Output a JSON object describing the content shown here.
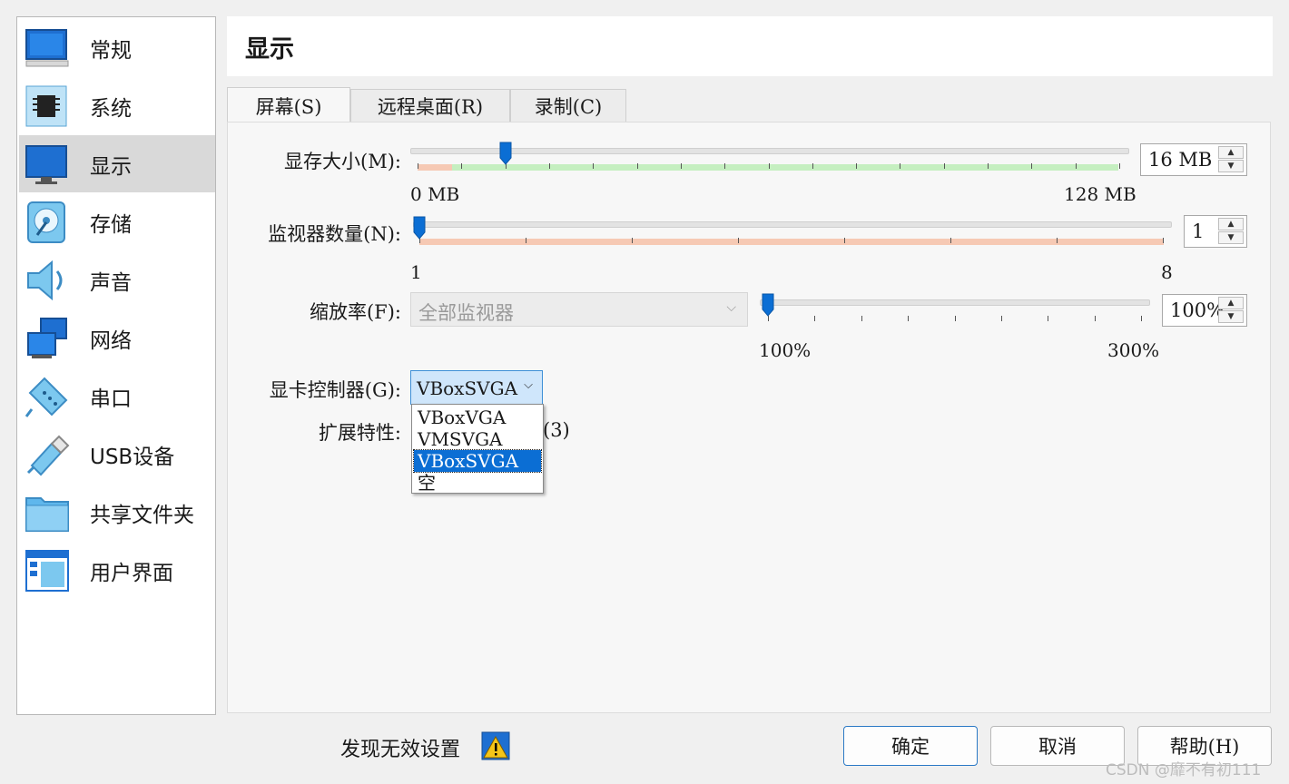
{
  "sidebar": {
    "items": [
      {
        "label": "常规",
        "icon": "monitor-general-icon"
      },
      {
        "label": "系统",
        "icon": "chip-icon"
      },
      {
        "label": "显示",
        "icon": "monitor-icon"
      },
      {
        "label": "存储",
        "icon": "disk-icon"
      },
      {
        "label": "声音",
        "icon": "speaker-icon"
      },
      {
        "label": "网络",
        "icon": "network-icon"
      },
      {
        "label": "串口",
        "icon": "serial-port-icon"
      },
      {
        "label": "USB设备",
        "icon": "usb-icon"
      },
      {
        "label": "共享文件夹",
        "icon": "folder-icon"
      },
      {
        "label": "用户界面",
        "icon": "user-interface-icon"
      }
    ],
    "selected_index": 2
  },
  "header": {
    "title": "显示"
  },
  "tabs": [
    {
      "label": "屏幕(S)",
      "active": true
    },
    {
      "label": "远程桌面(R)",
      "active": false
    },
    {
      "label": "录制(C)",
      "active": false
    }
  ],
  "video_memory": {
    "label": "显存大小(M):",
    "value": "16 MB",
    "value_mb": 16,
    "min_label": "0 MB",
    "max_label": "128 MB",
    "min": 0,
    "max": 128
  },
  "monitor_count": {
    "label": "监视器数量(N):",
    "value": "1",
    "min_label": "1",
    "max_label": "8",
    "min": 1,
    "max": 8
  },
  "scale": {
    "label": "缩放率(F):",
    "monitor_select": "全部监视器",
    "value": "100%",
    "min_label": "100%",
    "max_label": "300%",
    "min": 100,
    "max": 300
  },
  "graphics_controller": {
    "label": "显卡控制器(G):",
    "selected": "VBoxSVGA",
    "options": [
      "VBoxVGA",
      "VMSVGA",
      "VBoxSVGA",
      "空"
    ],
    "highlighted_index": 2
  },
  "extended": {
    "label": "扩展特性:",
    "partial_text": "(3)"
  },
  "footer": {
    "warning_text": "发现无效设置",
    "ok_label": "确定",
    "cancel_label": "取消",
    "help_label": "帮助(H)"
  },
  "watermark": "CSDN @靡不有初111",
  "colors": {
    "accent": "#0b6ed4",
    "slider_green": "#c5efc0",
    "slider_red": "#f6c9b4"
  }
}
